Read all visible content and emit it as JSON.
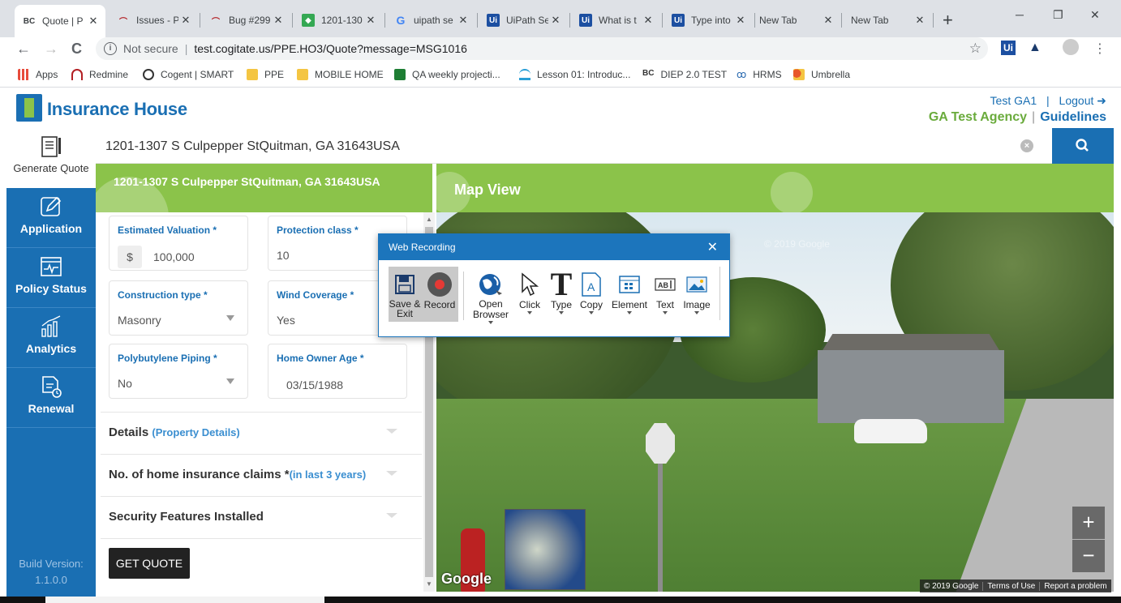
{
  "browser": {
    "tabs": [
      {
        "title": "Quote | P",
        "favicon": "bc-icon",
        "color": "#3c4043",
        "active": true
      },
      {
        "title": "Issues - P",
        "favicon": "redmine-icon",
        "color": "#b32024"
      },
      {
        "title": "Bug #299",
        "favicon": "redmine-icon",
        "color": "#b32024"
      },
      {
        "title": "1201-130",
        "favicon": "maps-icon",
        "color": "#34a853"
      },
      {
        "title": "uipath se",
        "favicon": "google-icon",
        "color": "#4285f4"
      },
      {
        "title": "UiPath Se",
        "favicon": "uipath-icon",
        "color": "#1c4fa1"
      },
      {
        "title": "What is t",
        "favicon": "uipath-icon",
        "color": "#1c4fa1"
      },
      {
        "title": "Type into",
        "favicon": "uipath-icon",
        "color": "#1c4fa1"
      },
      {
        "title": "New Tab",
        "favicon": "",
        "color": ""
      },
      {
        "title": "New Tab",
        "favicon": "",
        "color": ""
      }
    ],
    "new_tab": "+",
    "window_controls": {
      "minimize": "─",
      "restore": "❐",
      "close": "✕"
    },
    "nav": {
      "back": "←",
      "forward": "→",
      "reload": "C"
    },
    "security": "Not secure",
    "url": "test.cogitate.us/PPE.HO3/Quote?message=MSG1016",
    "star": "☆",
    "menu": "⋮",
    "bookmarks": [
      {
        "label": "Apps",
        "color": "#e74c3c"
      },
      {
        "label": "Redmine",
        "color": "#b32024"
      },
      {
        "label": "Cogent | SMART",
        "color": "#333333"
      },
      {
        "label": "PPE",
        "color": "#f4c542"
      },
      {
        "label": "MOBILE HOME",
        "color": "#f4c542"
      },
      {
        "label": "QA weekly projecti...",
        "color": "#1e7e34"
      },
      {
        "label": "Lesson 01: Introduc...",
        "color": "#2a9fd6"
      },
      {
        "label": "DIEP 2.0 TEST",
        "color": "#333333"
      },
      {
        "label": "HRMS",
        "color": "#2a6ab0"
      },
      {
        "label": "Umbrella",
        "color": "#e8572a"
      }
    ]
  },
  "header": {
    "logo": "Insurance House",
    "user": "Test GA1",
    "separator": "|",
    "logout": "Logout",
    "agency": "GA Test Agency",
    "guidelines": "Guidelines",
    "brand_blue": "#1a6fb3",
    "brand_green": "#8bc34a"
  },
  "sidebar": {
    "items": [
      {
        "label": "Generate Quote",
        "icon": "document-pencil-icon"
      },
      {
        "label": "Application",
        "icon": "edit-icon"
      },
      {
        "label": "Policy Status",
        "icon": "pulse-icon"
      },
      {
        "label": "Analytics",
        "icon": "bar-chart-icon"
      },
      {
        "label": "Renewal",
        "icon": "document-clock-icon"
      }
    ],
    "build_label": "Build Version:",
    "build_version": "1.1.0.0"
  },
  "search": {
    "value": "1201-1307 S Culpepper StQuitman, GA 31643USA"
  },
  "panel": {
    "address": "1201-1307 S Culpepper StQuitman, GA 31643USA",
    "map_title": "Map View"
  },
  "form": {
    "estimated_valuation": {
      "label": "Estimated Valuation *",
      "prefix": "$",
      "value": "100,000"
    },
    "protection_class": {
      "label": "Protection class *",
      "value": "10"
    },
    "construction_type": {
      "label": "Construction type *",
      "value": "Masonry"
    },
    "wind_coverage": {
      "label": "Wind Coverage *",
      "value": "Yes"
    },
    "polybutylene": {
      "label": "Polybutylene Piping *",
      "value": "No"
    },
    "home_owner_age": {
      "label": "Home Owner Age *",
      "value": "03/15/1988"
    },
    "sections": [
      {
        "title": "Details",
        "sub": "(Property Details)"
      },
      {
        "title": "No. of home insurance claims *",
        "sub": "(in last 3 years)"
      },
      {
        "title": "Security Features Installed",
        "sub": ""
      }
    ],
    "get_quote": "GET QUOTE"
  },
  "map": {
    "watermark": "Google",
    "street_watermark": "© 2019 Google",
    "footer": [
      "© 2019 Google",
      "Terms of Use",
      "Report a problem"
    ],
    "zoom_in": "+",
    "zoom_out": "−"
  },
  "recorder": {
    "title": "Web Recording",
    "close": "✕",
    "tools": [
      {
        "label": "Save & Exit",
        "icon": "floppy-icon"
      },
      {
        "label": "Record",
        "icon": "record-icon"
      },
      {
        "label": "Open Browser",
        "icon": "globe-icon"
      },
      {
        "label": "Click",
        "icon": "cursor-icon"
      },
      {
        "label": "Type",
        "icon": "type-icon"
      },
      {
        "label": "Copy",
        "icon": "copy-icon"
      },
      {
        "label": "Element",
        "icon": "element-icon"
      },
      {
        "label": "Text",
        "icon": "text-icon"
      },
      {
        "label": "Image",
        "icon": "image-icon"
      }
    ]
  }
}
